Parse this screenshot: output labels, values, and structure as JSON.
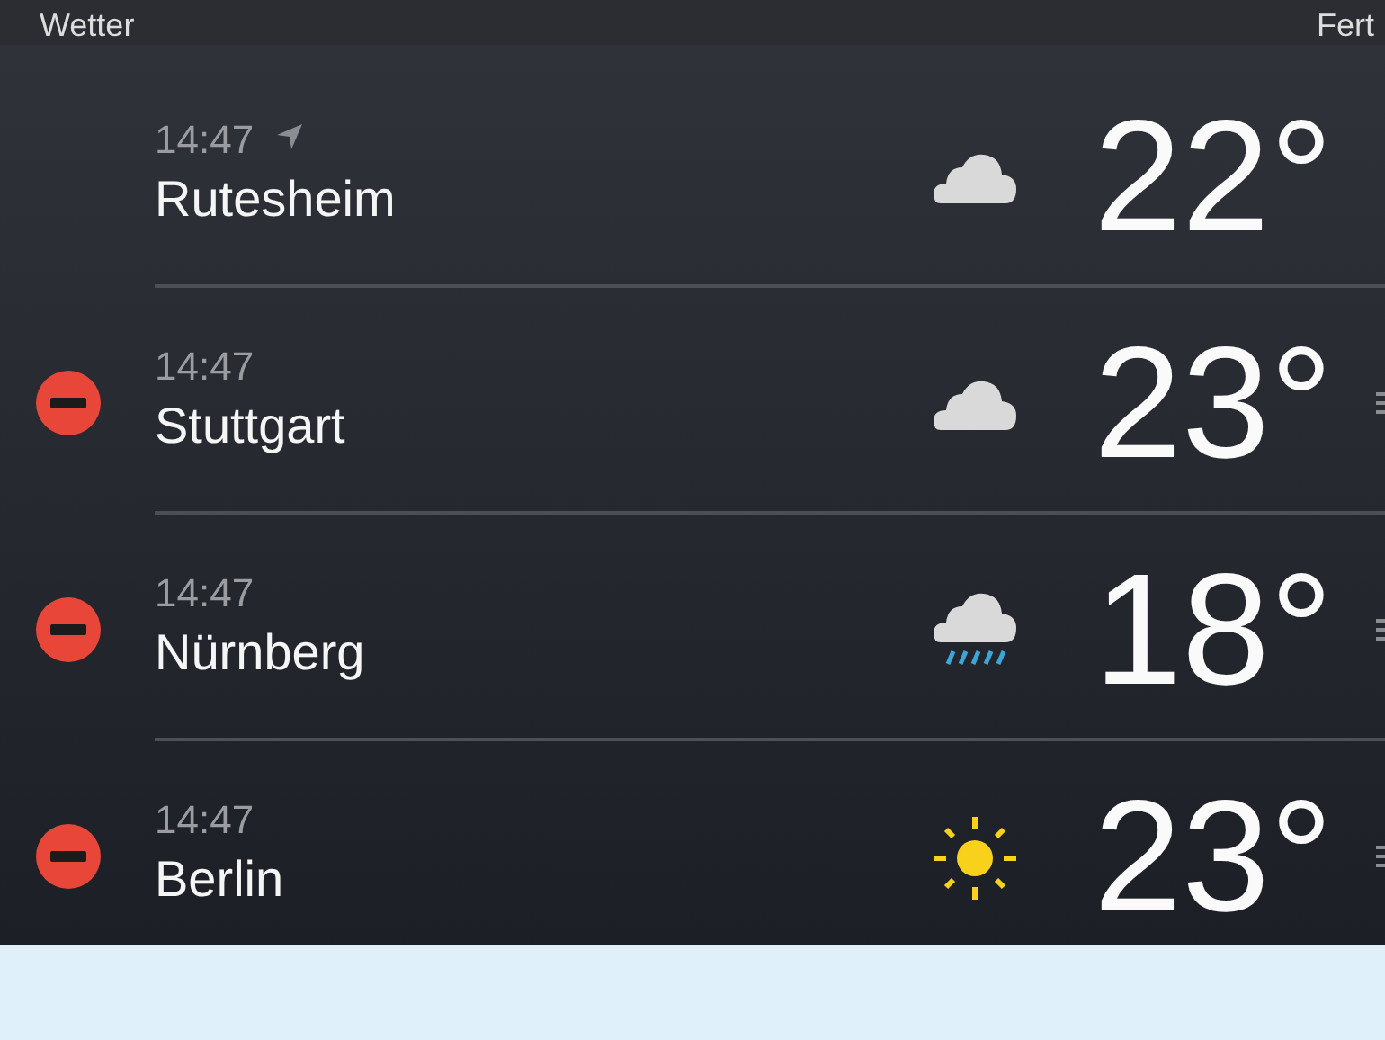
{
  "header": {
    "title": "Wetter",
    "action": "Fert"
  },
  "locations": [
    {
      "time": "14:47",
      "name": "Rutesheim",
      "current": true,
      "removable": false,
      "kind": "cloud",
      "temperature": "22°",
      "reorderable": false
    },
    {
      "time": "14:47",
      "name": "Stuttgart",
      "current": false,
      "removable": true,
      "kind": "cloud",
      "temperature": "23°",
      "reorderable": true
    },
    {
      "time": "14:47",
      "name": "Nürnberg",
      "current": false,
      "removable": true,
      "kind": "rain",
      "temperature": "18°",
      "reorderable": true
    },
    {
      "time": "14:47",
      "name": "Berlin",
      "current": false,
      "removable": true,
      "kind": "sun",
      "temperature": "23°",
      "reorderable": true
    }
  ]
}
